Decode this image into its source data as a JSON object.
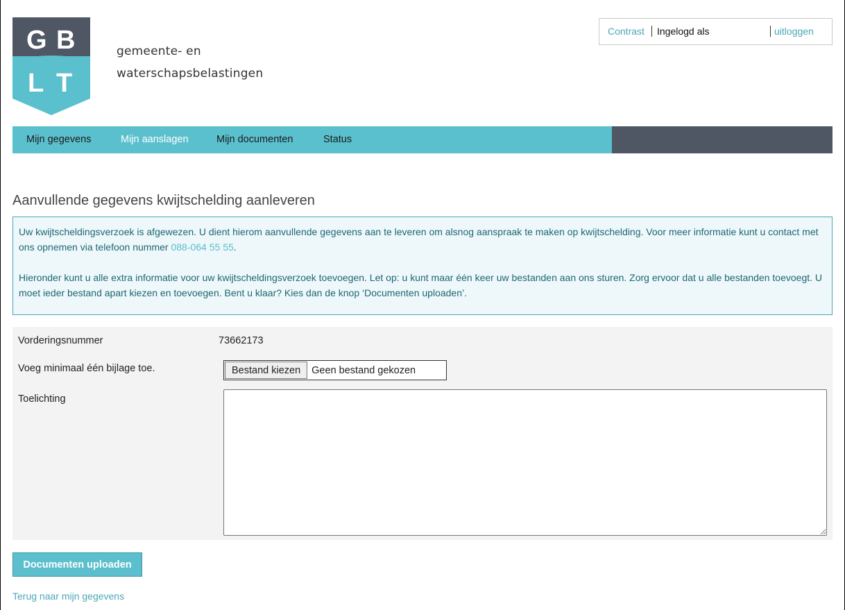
{
  "logo": {
    "letters": [
      "G",
      "B",
      "L",
      "T"
    ],
    "top_color": "#4e5763",
    "bottom_color": "#5bc0ce"
  },
  "site_name": {
    "line1": "gemeente- en",
    "line2": "waterschapsbelastingen"
  },
  "userbox": {
    "contrast": "Contrast",
    "logged_in": "Ingelogd als",
    "logout": "uitloggen"
  },
  "nav": {
    "items": [
      {
        "label": "Mijn gegevens",
        "active": false
      },
      {
        "label": "Mijn aanslagen",
        "active": true
      },
      {
        "label": "Mijn documenten",
        "active": false
      },
      {
        "label": "Status",
        "active": false
      }
    ]
  },
  "page": {
    "title": "Aanvullende gegevens kwijtschelding aanleveren"
  },
  "info": {
    "p1_text": "Uw kwijtscheldingsverzoek is afgewezen. U dient hierom aanvullende gegevens aan te leveren om alsnog aanspraak te maken op kwijtschelding. Voor meer informatie kunt u contact met ons opnemen via telefoon nummer ",
    "phone": "088-064 55 55",
    "p1_end": ".",
    "p2": "Hieronder kunt u alle extra informatie voor uw kwijtscheldingsverzoek toevoegen. Let op: u kunt maar één keer uw bestanden aan ons sturen. Zorg ervoor dat u alle bestanden toevoegt. U moet ieder bestand apart kiezen en toevoegen. Bent u klaar? Kies dan de knop ‘Documenten uploaden’."
  },
  "form": {
    "claim_label": "Vorderingsnummer",
    "claim_value": "73662173",
    "attachment_label": "Voeg minimaal één bijlage toe.",
    "file_button": "Bestand kiezen",
    "file_status": "Geen bestand gekozen",
    "note_label": "Toelichting",
    "note_value": ""
  },
  "actions": {
    "upload": "Documenten uploaden",
    "back": "Terug naar mijn gegevens"
  },
  "colors": {
    "accent": "#5bc0ce",
    "dark": "#4e5763",
    "link": "#4aa7b6"
  }
}
